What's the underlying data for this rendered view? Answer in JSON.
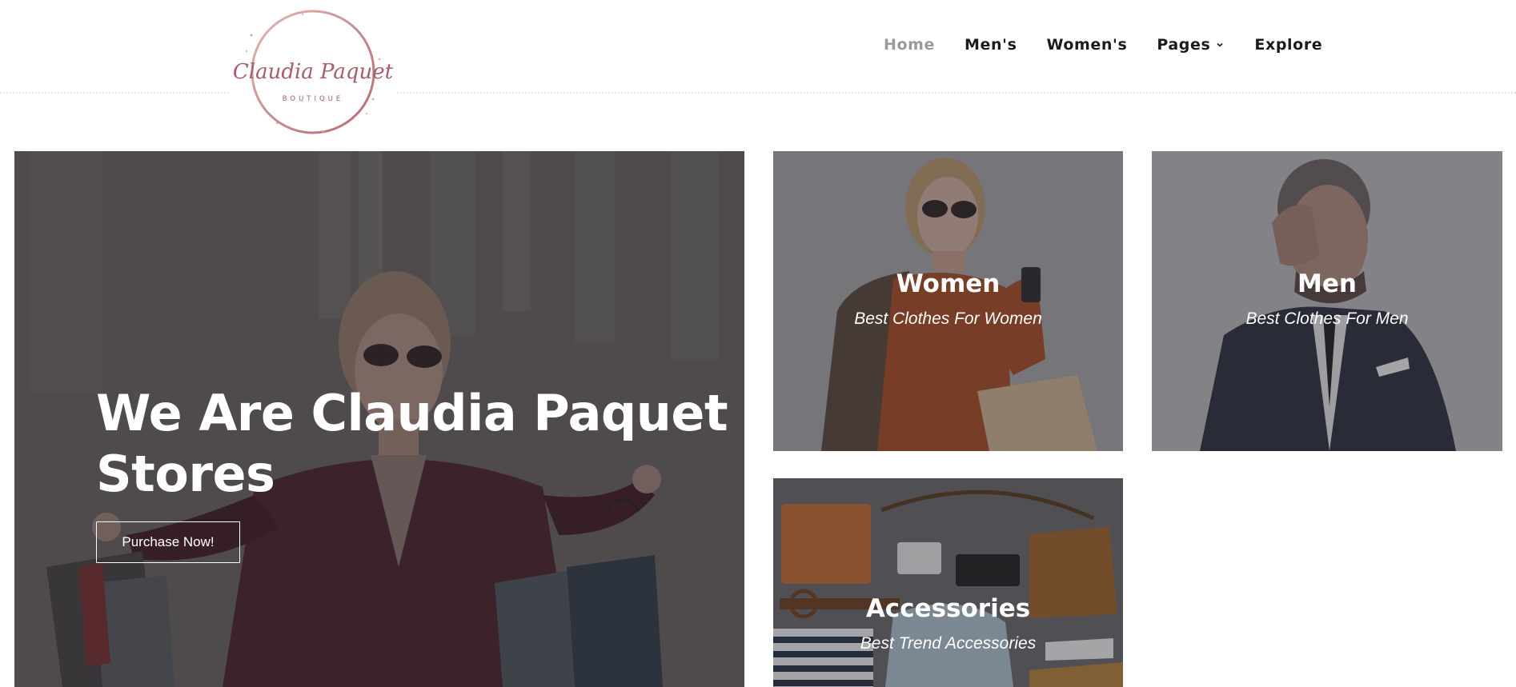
{
  "logo": {
    "script_text": "Claudia Paquet",
    "sub_text": "BOUTIQUE"
  },
  "nav": {
    "items": [
      {
        "label": "Home",
        "active": true
      },
      {
        "label": "Men's"
      },
      {
        "label": "Women's"
      },
      {
        "label": "Pages",
        "has_dropdown": true
      },
      {
        "label": "Explore"
      }
    ]
  },
  "hero": {
    "title_line1": "We Are Claudia Paquet",
    "title_line2": "Stores",
    "button_label": "Purchase Now!"
  },
  "tiles": {
    "women": {
      "title": "Women",
      "subtitle": "Best Clothes For Women"
    },
    "men": {
      "title": "Men",
      "subtitle": "Best Clothes For Men"
    },
    "accessories": {
      "title": "Accessories",
      "subtitle": "Best Trend Accessories"
    }
  },
  "colors": {
    "brand_rose": "#b8707a",
    "nav_active": "#9a9a9a",
    "nav_text": "#1b1b1b",
    "overlay": "rgba(30,30,30,0.45)"
  }
}
